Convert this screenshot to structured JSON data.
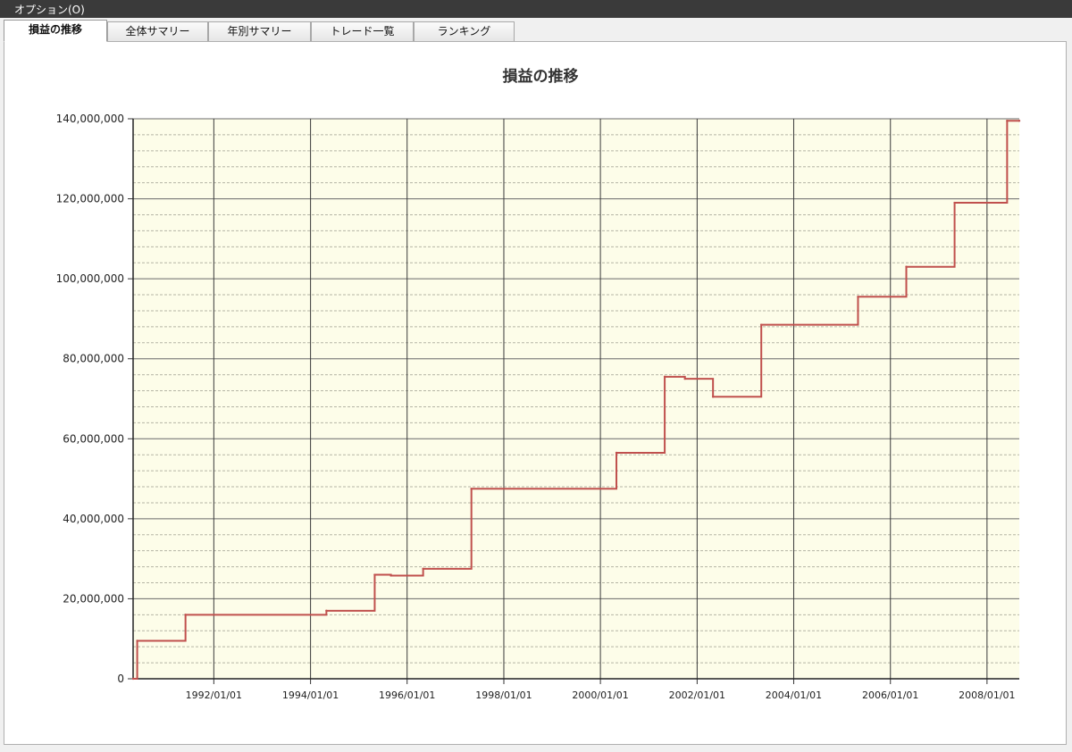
{
  "menu": {
    "options_label": "オプション(O)"
  },
  "tabs": [
    {
      "label": "損益の推移",
      "active": true
    },
    {
      "label": "全体サマリー",
      "active": false
    },
    {
      "label": "年別サマリー",
      "active": false
    },
    {
      "label": "トレード一覧",
      "active": false
    },
    {
      "label": "ランキング",
      "active": false
    }
  ],
  "colors": {
    "plot_background": "#fdfde9",
    "line": "#c0504d",
    "menubar": "#3a3a3a"
  },
  "chart_data": {
    "type": "line",
    "title": "損益の推移",
    "xlabel": "",
    "ylabel": "",
    "xlim": [
      "1990/05/01",
      "2008/09/01"
    ],
    "ylim": [
      0,
      140000000
    ],
    "grid": true,
    "legend": "none",
    "y_ticks": [
      0,
      20000000,
      40000000,
      60000000,
      80000000,
      100000000,
      120000000,
      140000000
    ],
    "y_tick_labels": [
      "0",
      "20,000,000",
      "40,000,000",
      "60,000,000",
      "80,000,000",
      "100,000,000",
      "120,000,000",
      "140,000,000"
    ],
    "x_ticks": [
      "1992/01/01",
      "1994/01/01",
      "1996/01/01",
      "1998/01/01",
      "2000/01/01",
      "2002/01/01",
      "2004/01/01",
      "2006/01/01",
      "2008/01/01"
    ],
    "x_tick_labels": [
      "1992/01/01",
      "1994/01/01",
      "1996/01/01",
      "1998/01/01",
      "2000/01/01",
      "2002/01/01",
      "2004/01/01",
      "2006/01/01",
      "2008/01/01"
    ],
    "series": [
      {
        "step": true,
        "x": [
          "1990/05/01",
          "1990/06/01",
          "1991/06/01",
          "1994/05/01",
          "1995/05/01",
          "1995/09/01",
          "1996/05/01",
          "1997/05/01",
          "2000/05/01",
          "2001/05/01",
          "2001/10/01",
          "2002/05/01",
          "2003/05/01",
          "2005/05/01",
          "2006/05/01",
          "2007/05/01",
          "2008/06/01",
          "2008/09/01"
        ],
        "y": [
          0,
          9500000,
          16000000,
          17000000,
          26000000,
          25800000,
          27500000,
          47500000,
          56500000,
          75500000,
          75000000,
          70500000,
          88500000,
          95500000,
          103000000,
          119000000,
          139500000,
          139500000
        ]
      }
    ]
  }
}
